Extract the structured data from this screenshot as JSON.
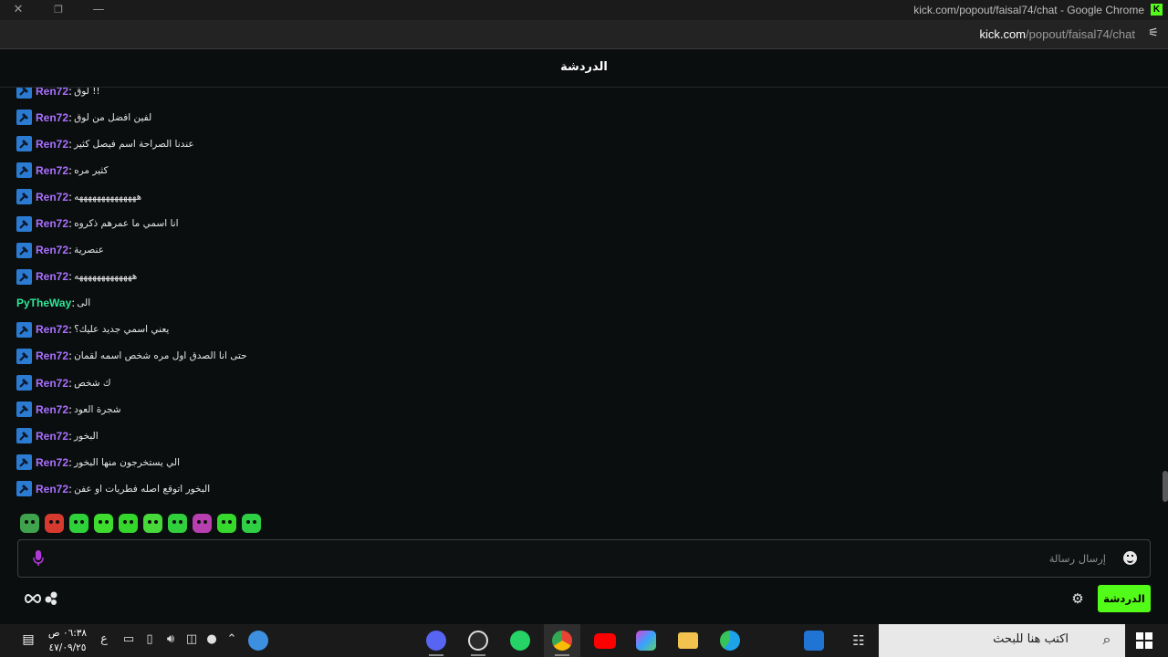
{
  "window": {
    "title": "kick.com/popout/faisal74/chat - Google Chrome",
    "close_glyph": "✕",
    "restore_glyph": "❐",
    "minimize_glyph": "—",
    "logo_letter": "K"
  },
  "address_bar": {
    "host": "kick.com",
    "path": "/popout/faisal74/chat"
  },
  "chat": {
    "header_title": "الدردشة",
    "messages": [
      {
        "user": "Ren72",
        "badge": true,
        "color": "#a970ff",
        "text": "لوق !!"
      },
      {
        "user": "Ren72",
        "badge": true,
        "color": "#a970ff",
        "text": "لفين افضل من لوق"
      },
      {
        "user": "Ren72",
        "badge": true,
        "color": "#a970ff",
        "text": "عندنا الصراحة اسم فيصل كثير"
      },
      {
        "user": "Ren72",
        "badge": true,
        "color": "#a970ff",
        "text": "كثير مره"
      },
      {
        "user": "Ren72",
        "badge": true,
        "color": "#a970ff",
        "text": "ههههههههههههههه"
      },
      {
        "user": "Ren72",
        "badge": true,
        "color": "#a970ff",
        "text": "انا اسمي ما عمرهم ذكروه"
      },
      {
        "user": "Ren72",
        "badge": true,
        "color": "#a970ff",
        "text": "عنصرية"
      },
      {
        "user": "Ren72",
        "badge": true,
        "color": "#a970ff",
        "text": "هههههههههههههه"
      },
      {
        "user": "PyTheWay",
        "badge": false,
        "color": "#2ee89a",
        "text": "الى"
      },
      {
        "user": "Ren72",
        "badge": true,
        "color": "#a970ff",
        "text": "يعني اسمي جديد عليك؟"
      },
      {
        "user": "Ren72",
        "badge": true,
        "color": "#a970ff",
        "text": "حتى انا الصدق اول مره شخص اسمه لقمان"
      },
      {
        "user": "Ren72",
        "badge": true,
        "color": "#a970ff",
        "text": "ك شخص"
      },
      {
        "user": "Ren72",
        "badge": true,
        "color": "#a970ff",
        "text": "شجرة العود"
      },
      {
        "user": "Ren72",
        "badge": true,
        "color": "#a970ff",
        "text": "البخور"
      },
      {
        "user": "Ren72",
        "badge": true,
        "color": "#a970ff",
        "text": "الي يستخرجون منها البخور"
      },
      {
        "user": "Ren72",
        "badge": true,
        "color": "#a970ff",
        "text": "البخور اتوقع اصله فطريات او عفن"
      }
    ],
    "separator": ":",
    "input_placeholder": "إرسال رسالة",
    "send_button": "الدردشة",
    "emote_colors": [
      "#3fa34d",
      "#d63a2f",
      "#2fd13a",
      "#3ddc2f",
      "#35d62b",
      "#47d93a",
      "#30cf3c",
      "#b83fb0",
      "#36d82c",
      "#2fcf45"
    ]
  },
  "taskbar": {
    "search_placeholder": "اكتب هنا للبحث",
    "time": "٠٦:٣٨ ص",
    "date": "٤٧/٠٩/٢٥",
    "language": "ع"
  }
}
